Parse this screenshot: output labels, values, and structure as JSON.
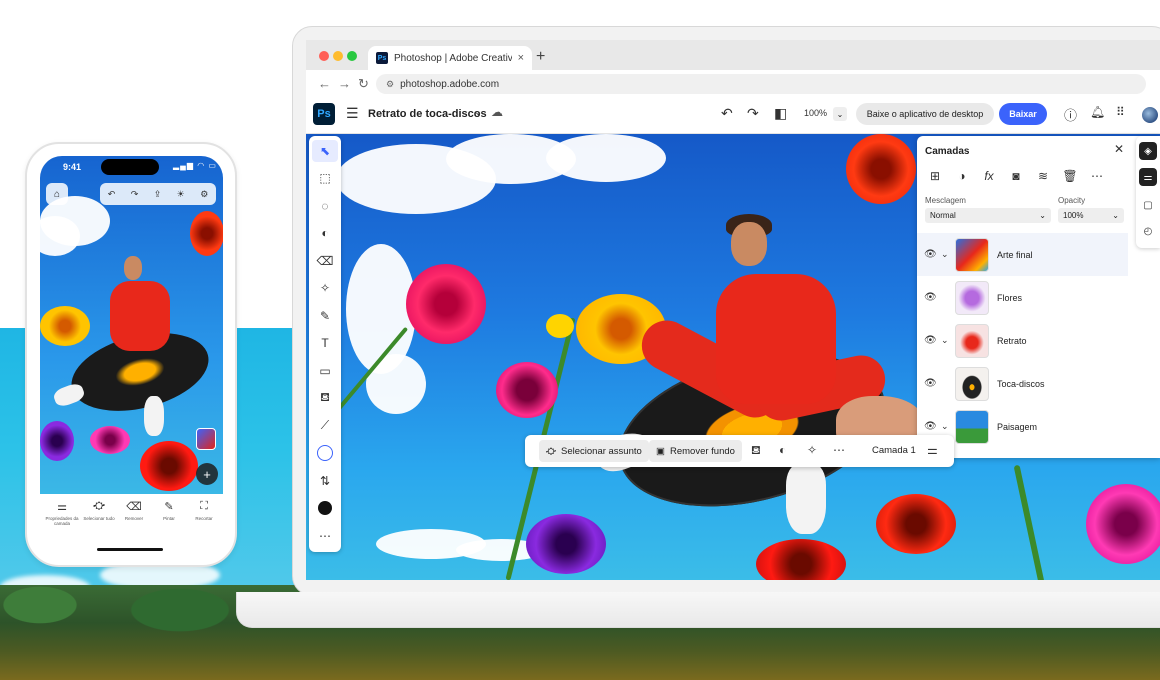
{
  "browser": {
    "tab_title": "Photoshop | Adobe Creative Cloud",
    "tab_favicon": "Ps",
    "url": "photoshop.adobe.com"
  },
  "appbar": {
    "logo": "Ps",
    "document_title": "Retrato de toca-discos",
    "zoom": "100%",
    "desktop_button": "Baixe o aplicativo de desktop",
    "download_button": "Baixar"
  },
  "toolbar": {
    "tools": [
      "select-icon",
      "object-select-icon",
      "lasso-icon",
      "adjust-icon",
      "eraser-icon",
      "healing-icon",
      "brush-icon",
      "type-icon",
      "rectangle-icon",
      "fill-icon",
      "eyedropper-icon",
      "swap-icon",
      "more-icon"
    ]
  },
  "layers_panel": {
    "title": "Camadas",
    "blend_label": "Mesclagem",
    "blend_value": "Normal",
    "opacity_label": "Opacity",
    "opacity_value": "100%",
    "layers": [
      {
        "name": "Arte final",
        "selected": true,
        "group": true
      },
      {
        "name": "Flores",
        "selected": false,
        "group": false
      },
      {
        "name": "Retrato",
        "selected": false,
        "group": true
      },
      {
        "name": "Toca-discos",
        "selected": false,
        "group": false
      },
      {
        "name": "Paisagem",
        "selected": false,
        "group": true
      }
    ]
  },
  "context_bar": {
    "select_subject": "Selecionar assunto",
    "remove_background": "Remover fundo",
    "layer_label": "Camada 1"
  },
  "phone": {
    "time": "9:41",
    "status": "▂▄▆ ◠ ▭",
    "bottom_items": [
      {
        "icon": "sliders-icon",
        "label": "Propriedades da camada"
      },
      {
        "icon": "subject-icon",
        "label": "Selecionar tudo"
      },
      {
        "icon": "eraser-icon",
        "label": "Remover"
      },
      {
        "icon": "brush-icon",
        "label": "Pintar"
      },
      {
        "icon": "crop-icon",
        "label": "Recortar"
      }
    ]
  },
  "colors": {
    "accent": "#3b63fb",
    "ps_dark": "#001e36",
    "ps_blue": "#31a8ff",
    "person_red": "#e8281b"
  }
}
